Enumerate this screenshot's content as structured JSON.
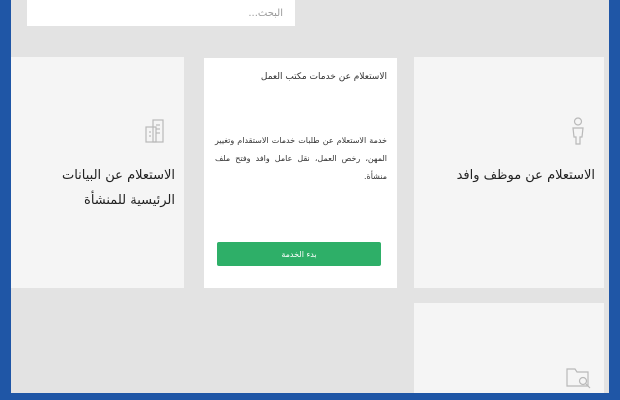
{
  "search": {
    "placeholder": "البحث..."
  },
  "cards": {
    "establishment": {
      "title": "الاستعلام عن البيانات الرئيسية للمنشأة",
      "icon": "building-icon"
    },
    "labor_office": {
      "title": "الاستعلام عن خدمات مكتب العمل",
      "description": "خدمة الاستعلام عن طلبات خدمات الاستقدام وتغيير المهن، رخص العمل، نقل عامل وافد وفتح ملف منشأة.",
      "button_label": "بدء الخدمة"
    },
    "expat_employee": {
      "title": "الاستعلام عن موظف وافد",
      "icon": "person-icon"
    },
    "bottom": {
      "icon": "folder-search-icon"
    }
  },
  "colors": {
    "frame": "#1f56a6",
    "background": "#e3e3e3",
    "button": "#2eaf68"
  }
}
